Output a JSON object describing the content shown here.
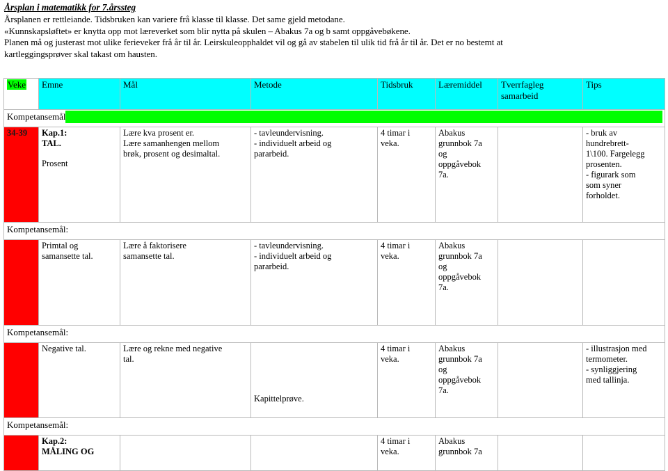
{
  "document": {
    "title": "Årsplan i matematikk for 7.årssteg",
    "intro_lines": [
      "Årsplanen er rettleiande. Tidsbruken kan variere frå klasse til klasse.  Det same gjeld metodane.",
      "«Kunnskapsløftet» er knytta opp mot læreverket som blir nytta på skulen – Abakus 7a og b samt oppgåvebøkene.",
      "Planen må og justerast mot ulike ferieveker frå år til år. Leirskuleopphaldet vil og gå av stabelen til ulik tid frå år til år. Det er no bestemt at",
      "kartleggingsprøver skal takast om hausten."
    ]
  },
  "colors": {
    "header_bg": "#00FFFF",
    "veke_highlight": "#00FF00",
    "week_cell": "#FF0000",
    "grid_line": "#B9B9B9"
  },
  "table": {
    "headers": {
      "veke": "Veke",
      "emne": "Emne",
      "mal": "Mål",
      "metode": "Metode",
      "tidsbruk": "Tidsbruk",
      "laeremiddel": "Læremiddel",
      "tverrfagleg": "Tverrfagleg",
      "samarbeid": "samarbeid",
      "tips": "Tips"
    },
    "kompetansemal_labels": {
      "first": "Kompetansemål",
      "rest": "Kompetansemål:"
    },
    "rows": [
      {
        "veke": "34-39",
        "emne_bold_1": "Kap.1:",
        "emne_bold_2": "TAL.",
        "emne_plain": "Prosent",
        "mal_1": "Lære kva prosent er.",
        "mal_2": "Lære samanhengen mellom",
        "mal_3": "brøk, prosent og desimaltal.",
        "metode_1": "- tavleundervisning.",
        "metode_2": "- individuelt arbeid og",
        "metode_3": "pararbeid.",
        "tidsbruk_1": "4 timar i",
        "tidsbruk_2": "veka.",
        "laeremiddel_1": "Abakus",
        "laeremiddel_2": "grunnbok 7a",
        "laeremiddel_3": "og",
        "laeremiddel_4": "oppgåvebok",
        "laeremiddel_5": "7a.",
        "tverrfagleg": "",
        "tips_1": "- bruk av",
        "tips_2": "hundrebrett-",
        "tips_3": "1\\100. Fargelegg",
        "tips_4": "prosenten.",
        "tips_5": "- figurark som",
        "tips_6": "som syner",
        "tips_7": "forholdet."
      },
      {
        "veke": "",
        "emne_1": "Primtal og",
        "emne_2": "samansette tal.",
        "mal_1": "Lære å faktorisere",
        "mal_2": "samansette tal.",
        "metode_1": "- tavleundervisning.",
        "metode_2": "- individuelt arbeid og",
        "metode_3": "pararbeid.",
        "tidsbruk_1": "4 timar i",
        "tidsbruk_2": "veka.",
        "laeremiddel_1": "Abakus",
        "laeremiddel_2": "grunnbok 7a",
        "laeremiddel_3": "og",
        "laeremiddel_4": "oppgåvebok",
        "laeremiddel_5": "7a.",
        "tverrfagleg": "",
        "tips": ""
      },
      {
        "veke": "",
        "emne_1": "Negative tal.",
        "mal_1": "Lære og rekne med negative",
        "mal_2": "tal.",
        "metode_late": "Kapittelprøve.",
        "tidsbruk_1": "4 timar i",
        "tidsbruk_2": "veka.",
        "laeremiddel_1": "Abakus",
        "laeremiddel_2": "grunnbok 7a",
        "laeremiddel_3": "og",
        "laeremiddel_4": "oppgåvebok",
        "laeremiddel_5": "7a.",
        "tverrfagleg": "",
        "tips_1": "- illustrasjon med",
        "tips_2": "termometer.",
        "tips_3": "- synliggjering",
        "tips_4": "med tallinja."
      },
      {
        "veke": "",
        "emne_bold_1": "Kap.2:",
        "emne_bold_2": "MÅLING OG",
        "mal": "",
        "metode": "",
        "tidsbruk_1": "4 timar i",
        "tidsbruk_2": "veka.",
        "laeremiddel_1": "Abakus",
        "laeremiddel_2": "grunnbok 7a",
        "tverrfagleg": "",
        "tips": ""
      }
    ]
  }
}
